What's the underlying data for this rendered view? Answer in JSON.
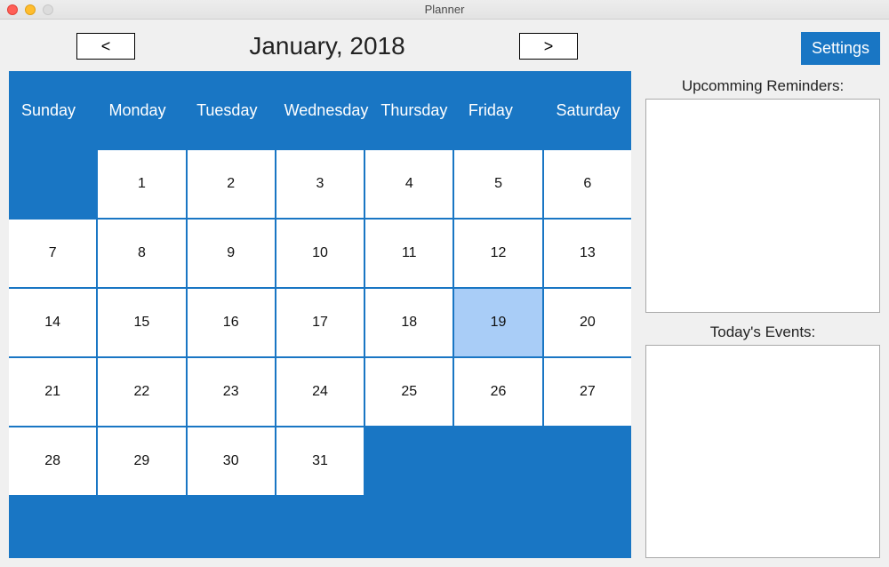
{
  "window": {
    "title": "Planner"
  },
  "header": {
    "prev_label": "<",
    "next_label": ">",
    "month_label": "January, 2018",
    "settings_label": "Settings"
  },
  "calendar": {
    "days_of_week": [
      "Sunday",
      "Monday",
      "Tuesday",
      "Wednesday",
      "Thursday",
      "Friday",
      "Saturday"
    ],
    "cells": [
      null,
      1,
      2,
      3,
      4,
      5,
      6,
      7,
      8,
      9,
      10,
      11,
      12,
      13,
      14,
      15,
      16,
      17,
      18,
      19,
      20,
      21,
      22,
      23,
      24,
      25,
      26,
      27,
      28,
      29,
      30,
      31,
      null,
      null,
      null
    ],
    "today": 19
  },
  "side": {
    "reminders_label": "Upcomming Reminders:",
    "events_label": "Today's Events:"
  },
  "colors": {
    "accent": "#1976c4",
    "today_highlight": "#a9cdf7"
  }
}
